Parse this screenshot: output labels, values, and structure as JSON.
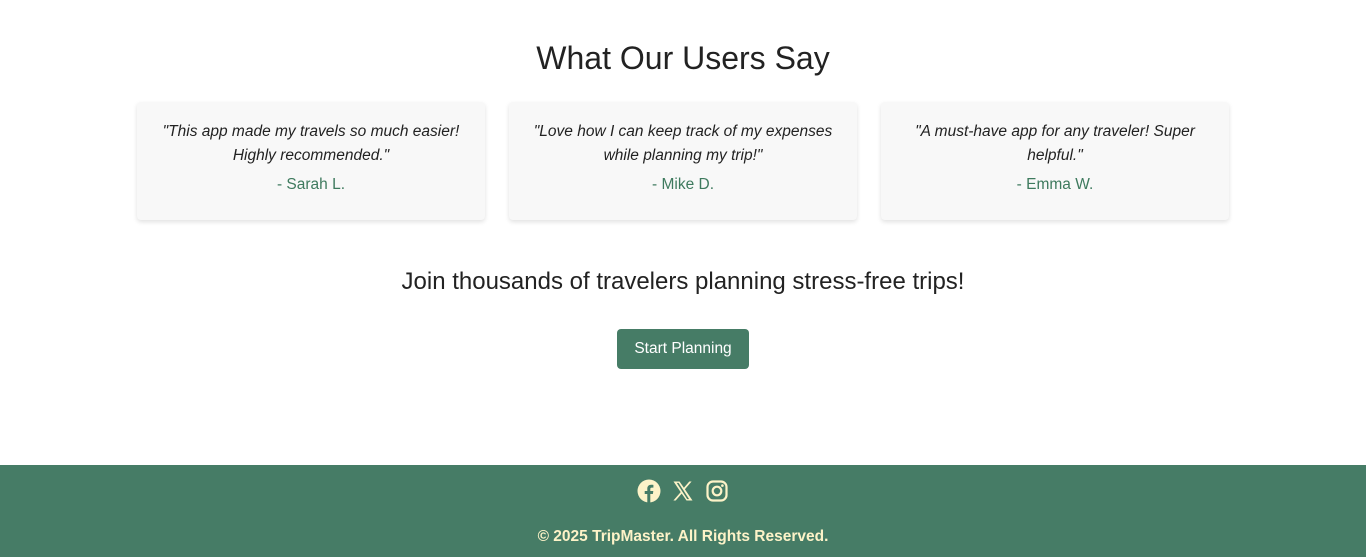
{
  "testimonials": {
    "title": "What Our Users Say",
    "items": [
      {
        "quote": "\"This app made my travels so much easier! Highly recommended.\"",
        "author": "- Sarah L."
      },
      {
        "quote": "\"Love how I can keep track of my expenses while planning my trip!\"",
        "author": "- Mike D."
      },
      {
        "quote": "\"A must-have app for any traveler! Super helpful.\"",
        "author": "- Emma W."
      }
    ]
  },
  "cta": {
    "text": "Join thousands of travelers planning stress-free trips!",
    "button_label": "Start Planning"
  },
  "footer": {
    "social_icons": [
      "facebook-icon",
      "x-icon",
      "instagram-icon"
    ],
    "copyright": "© 2025 TripMaster. All Rights Reserved."
  },
  "colors": {
    "accent": "#467c66",
    "author_text": "#3e7a5e",
    "footer_text": "#fdf3c8",
    "card_bg": "#f8f8f8"
  }
}
